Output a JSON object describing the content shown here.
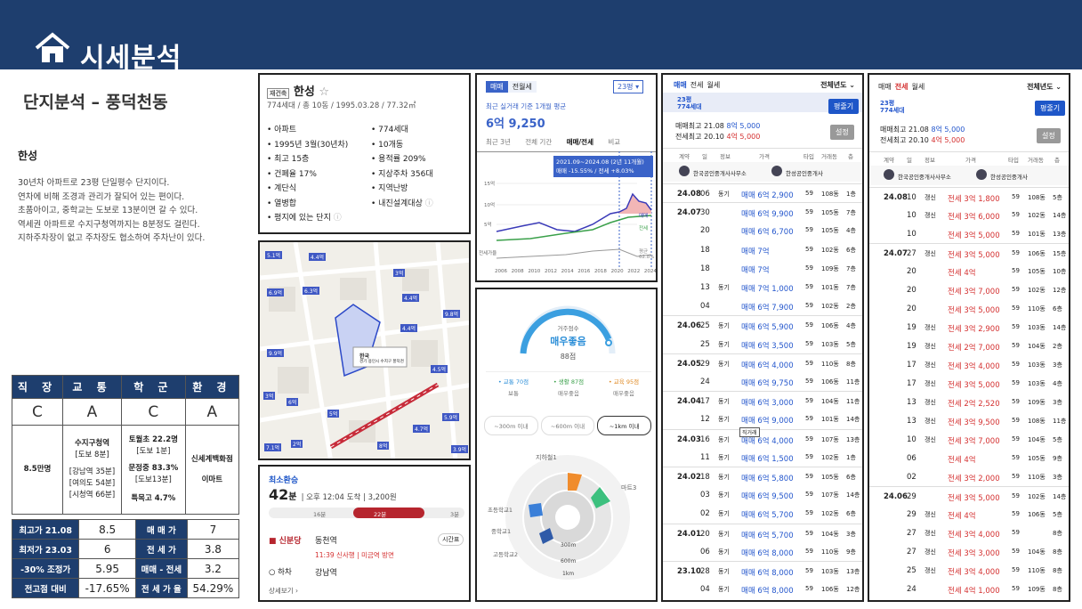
{
  "header": {
    "title": "시세분석"
  },
  "left": {
    "heading": "단지분석 – 풍덕천동",
    "complex_name": "한성",
    "description": [
      "30년차 아파트로 23평 단일평수 단지이다.",
      "연차에 비해 조경과 관리가 잘되어 있는 편이다.",
      "초품아이고, 중학교는 도보로 13분이면 갈 수 있다.",
      "역세권 아파트로 수지구청역까지는 8분정도 걸린다.",
      "지하주차장이 없고 주차장도 협소하여 주차난이 있다."
    ],
    "eval_table": {
      "headers": [
        "직 장",
        "교 통",
        "학 군",
        "환 경"
      ],
      "grades": [
        "C",
        "A",
        "C",
        "A"
      ],
      "work": "8.5만명",
      "transport": {
        "station": "수지구청역",
        "walk": "[도보 8분]",
        "lines": [
          "[강남역 35분]",
          "[여의도 54분]",
          "[시청역 66분]"
        ]
      },
      "school": {
        "elem": "토월초 22.2명",
        "elem_walk": "[도보 1분]",
        "mid": "문정중 83.3%",
        "mid_walk": "[도보13분]",
        "special": "특목고 4.7%"
      },
      "env": {
        "store": "신세계백화점",
        "mart": "이마트"
      }
    },
    "score_table": [
      {
        "k1": "최고가 21.08",
        "v1": "8.5",
        "k2": "매 매 가",
        "v2": "7"
      },
      {
        "k1": "최저가 23.03",
        "v1": "6",
        "k2": "전 세 가",
        "v2": "3.8"
      },
      {
        "k1": "-30% 조정가",
        "v1": "5.95",
        "k2": "매매 - 전세",
        "v2": "3.2"
      },
      {
        "k1": "전고점 대비",
        "v1": "-17.65%",
        "k2": "전 세 가 율",
        "v2": "54.29%"
      }
    ]
  },
  "info": {
    "tag": "재건축",
    "name": "한성",
    "sub": "774세대 / 총 10동 / 1995.03.28 / 77.32㎡",
    "left": [
      "아파트",
      "1995년 3월(30년차)",
      "최고 15층",
      "건폐율 17%",
      "계단식",
      "열병합",
      "평지에 있는 단지"
    ],
    "right": [
      "774세대",
      "10개동",
      "용적률 209%",
      "지상주차 356대",
      "지역난방",
      "내진설계대상"
    ]
  },
  "price_chart": {
    "tabs": [
      "매매",
      "전월세"
    ],
    "size": "23평",
    "caption": "최근 실거래 기준 1개월 평균",
    "price": "6억 9,250",
    "subtabs": [
      "최근 3년",
      "전체 기간",
      "매매/전세",
      "비교"
    ],
    "tooltip": [
      "2021.09~2024.08 (2년 11개월)",
      "매매 -15.55% / 전세 +8.03%"
    ],
    "y_ticks": [
      "15억",
      "10억",
      "5억",
      "전세가율"
    ],
    "x_ticks": [
      "2006",
      "2008",
      "2010",
      "2012",
      "2014",
      "2016",
      "2018",
      "2020",
      "2022",
      "2024"
    ],
    "labels": [
      "매매",
      "전세",
      "평균",
      "62.8%"
    ]
  },
  "map": {
    "labels": [
      "5.1억",
      "4.4억",
      "3억",
      "6.9억",
      "6.3억",
      "4.4억",
      "9.8억",
      "4.4억",
      "9.9억",
      "3억",
      "6억",
      "5억",
      "4.5억",
      "5.9억",
      "4.7억",
      "7.1억",
      "2억",
      "8억",
      "3.9억"
    ],
    "callout": "한국",
    "callout2": "경기 용인시 수지구 풍덕천동 696"
  },
  "transit": {
    "title": "최소환승",
    "minutes": "42",
    "unit": "분",
    "detail": "| 오후 12:04 도착  | 3,200원",
    "seg1": "16분",
    "seg2": "22분",
    "seg3": "3분",
    "line": "신분당",
    "from": "동천역",
    "time": "11:39 신사행 | 미금역 방면",
    "timetable": "시간표",
    "to_label": "하차",
    "to": "강남역",
    "more": "상세보기 ›"
  },
  "score": {
    "label": "거주점수",
    "grade": "매우좋음",
    "points": "88점",
    "items": [
      {
        "k": "• 교통 70점",
        "v": "보통"
      },
      {
        "k": "• 생활 87점",
        "v": "매우좋음"
      },
      {
        "k": "• 교육 95점",
        "v": "매우좋음"
      }
    ],
    "ranges": [
      "~300m 이내",
      "~600m 이내",
      "~1km 이내"
    ],
    "ring_labels": [
      "지하철1",
      "마트3",
      "초등학교1",
      "중학교1",
      "고등학교2",
      "300m",
      "600m",
      "1km"
    ]
  },
  "sale": {
    "tabs": [
      "매매",
      "전세",
      "월세"
    ],
    "filter": "전체년도 ⌄",
    "size": "23평",
    "households": "774세대",
    "btn": "평줄기",
    "max": "매매최고 21.08",
    "max_v": "8억 5,000",
    "jeon": "전세최고 20.10",
    "jeon_v": "4억 5,000",
    "set": "설정",
    "cols": [
      "계약",
      "일",
      "정보",
      "가격",
      "타입",
      "거래동",
      "층"
    ],
    "agent1": "한국공인중개사사무소",
    "agent2": "한성공인중개사",
    "rows": [
      [
        "24.08",
        "06",
        "동기",
        "매매 6억 2,900",
        "59",
        "108동",
        "1층"
      ],
      [
        "24.07",
        "30",
        "",
        "매매 6억 9,900",
        "59",
        "105동",
        "7층"
      ],
      [
        "",
        "20",
        "",
        "매매 6억 6,700",
        "59",
        "105동",
        "4층"
      ],
      [
        "",
        "18",
        "",
        "매매 7억",
        "59",
        "102동",
        "6층"
      ],
      [
        "",
        "18",
        "",
        "매매 7억",
        "59",
        "109동",
        "7층"
      ],
      [
        "",
        "13",
        "동기",
        "매매 7억 1,000",
        "59",
        "101동",
        "7층"
      ],
      [
        "",
        "04",
        "",
        "매매 6억 7,900",
        "59",
        "102동",
        "2층"
      ],
      [
        "24.06",
        "25",
        "동기",
        "매매 6억 5,900",
        "59",
        "106동",
        "4층"
      ],
      [
        "",
        "25",
        "동기",
        "매매 6억 3,500",
        "59",
        "103동",
        "5층"
      ],
      [
        "24.05",
        "29",
        "동기",
        "매매 6억 4,000",
        "59",
        "110동",
        "8층"
      ],
      [
        "",
        "24",
        "",
        "매매 6억 9,750",
        "59",
        "106동",
        "11층"
      ],
      [
        "24.04",
        "17",
        "동기",
        "매매 6억 3,000",
        "59",
        "104동",
        "11층"
      ],
      [
        "",
        "12",
        "동기",
        "매매 6억 9,000",
        "59",
        "101동",
        "14층"
      ],
      [
        "24.03",
        "16",
        "동기",
        "매매 6억 4,000",
        "59",
        "107동",
        "13층"
      ],
      [
        "",
        "11",
        "동기",
        "매매 6억 1,500",
        "59",
        "102동",
        "1층"
      ],
      [
        "24.02",
        "18",
        "동기",
        "매매 6억 5,800",
        "59",
        "105동",
        "6층"
      ],
      [
        "",
        "03",
        "동기",
        "매매 6억 9,500",
        "59",
        "107동",
        "14층"
      ],
      [
        "",
        "02",
        "동기",
        "매매 6억 5,700",
        "59",
        "102동",
        "6층"
      ],
      [
        "24.01",
        "20",
        "동기",
        "매매 6억 5,700",
        "59",
        "104동",
        "3층"
      ],
      [
        "",
        "06",
        "동기",
        "매매 6억 8,000",
        "59",
        "110동",
        "9층"
      ],
      [
        "23.10",
        "28",
        "동기",
        "매매 6억 8,000",
        "59",
        "103동",
        "13층"
      ],
      [
        "",
        "04",
        "동기",
        "매매 6억 8,000",
        "59",
        "106동",
        "12층"
      ]
    ],
    "flag": "직거래"
  },
  "jeonse": {
    "rows": [
      [
        "24.08",
        "10",
        "갱신",
        "전세 3억 1,800",
        "59",
        "108동",
        "5층"
      ],
      [
        "",
        "10",
        "갱신",
        "전세 3억 6,000",
        "59",
        "102동",
        "14층"
      ],
      [
        "",
        "10",
        "",
        "전세 3억 5,000",
        "59",
        "101동",
        "13층"
      ],
      [
        "24.07",
        "27",
        "갱신",
        "전세 3억 5,000",
        "59",
        "106동",
        "15층"
      ],
      [
        "",
        "20",
        "",
        "전세 4억",
        "59",
        "105동",
        "10층"
      ],
      [
        "",
        "20",
        "",
        "전세 3억 7,000",
        "59",
        "102동",
        "12층"
      ],
      [
        "",
        "20",
        "",
        "전세 3억 5,000",
        "59",
        "110동",
        "6층"
      ],
      [
        "",
        "19",
        "갱신",
        "전세 3억 2,900",
        "59",
        "103동",
        "14층"
      ],
      [
        "",
        "19",
        "갱신",
        "전세 2억 7,000",
        "59",
        "104동",
        "2층"
      ],
      [
        "",
        "17",
        "갱신",
        "전세 3억 4,000",
        "59",
        "103동",
        "3층"
      ],
      [
        "",
        "17",
        "갱신",
        "전세 3억 5,000",
        "59",
        "103동",
        "4층"
      ],
      [
        "",
        "13",
        "갱신",
        "전세 2억 2,520",
        "59",
        "109동",
        "3층"
      ],
      [
        "",
        "13",
        "갱신",
        "전세 3억 9,500",
        "59",
        "108동",
        "11층"
      ],
      [
        "",
        "10",
        "갱신",
        "전세 3억 7,000",
        "59",
        "104동",
        "5층"
      ],
      [
        "",
        "06",
        "",
        "전세 4억",
        "59",
        "105동",
        "9층"
      ],
      [
        "",
        "02",
        "",
        "전세 3억 2,000",
        "59",
        "110동",
        "3층"
      ],
      [
        "24.06",
        "29",
        "",
        "전세 3억 5,000",
        "59",
        "102동",
        "14층"
      ],
      [
        "",
        "29",
        "갱신",
        "전세 4억",
        "59",
        "106동",
        "5층"
      ],
      [
        "",
        "27",
        "갱신",
        "전세 3억 4,000",
        "59",
        "",
        "8층"
      ],
      [
        "",
        "27",
        "갱신",
        "전세 3억 3,000",
        "59",
        "104동",
        "8층"
      ],
      [
        "",
        "25",
        "갱신",
        "전세 3억 4,000",
        "59",
        "110동",
        "8층"
      ],
      [
        "",
        "24",
        "",
        "전세 4억 1,000",
        "59",
        "109동",
        "8층"
      ]
    ]
  }
}
